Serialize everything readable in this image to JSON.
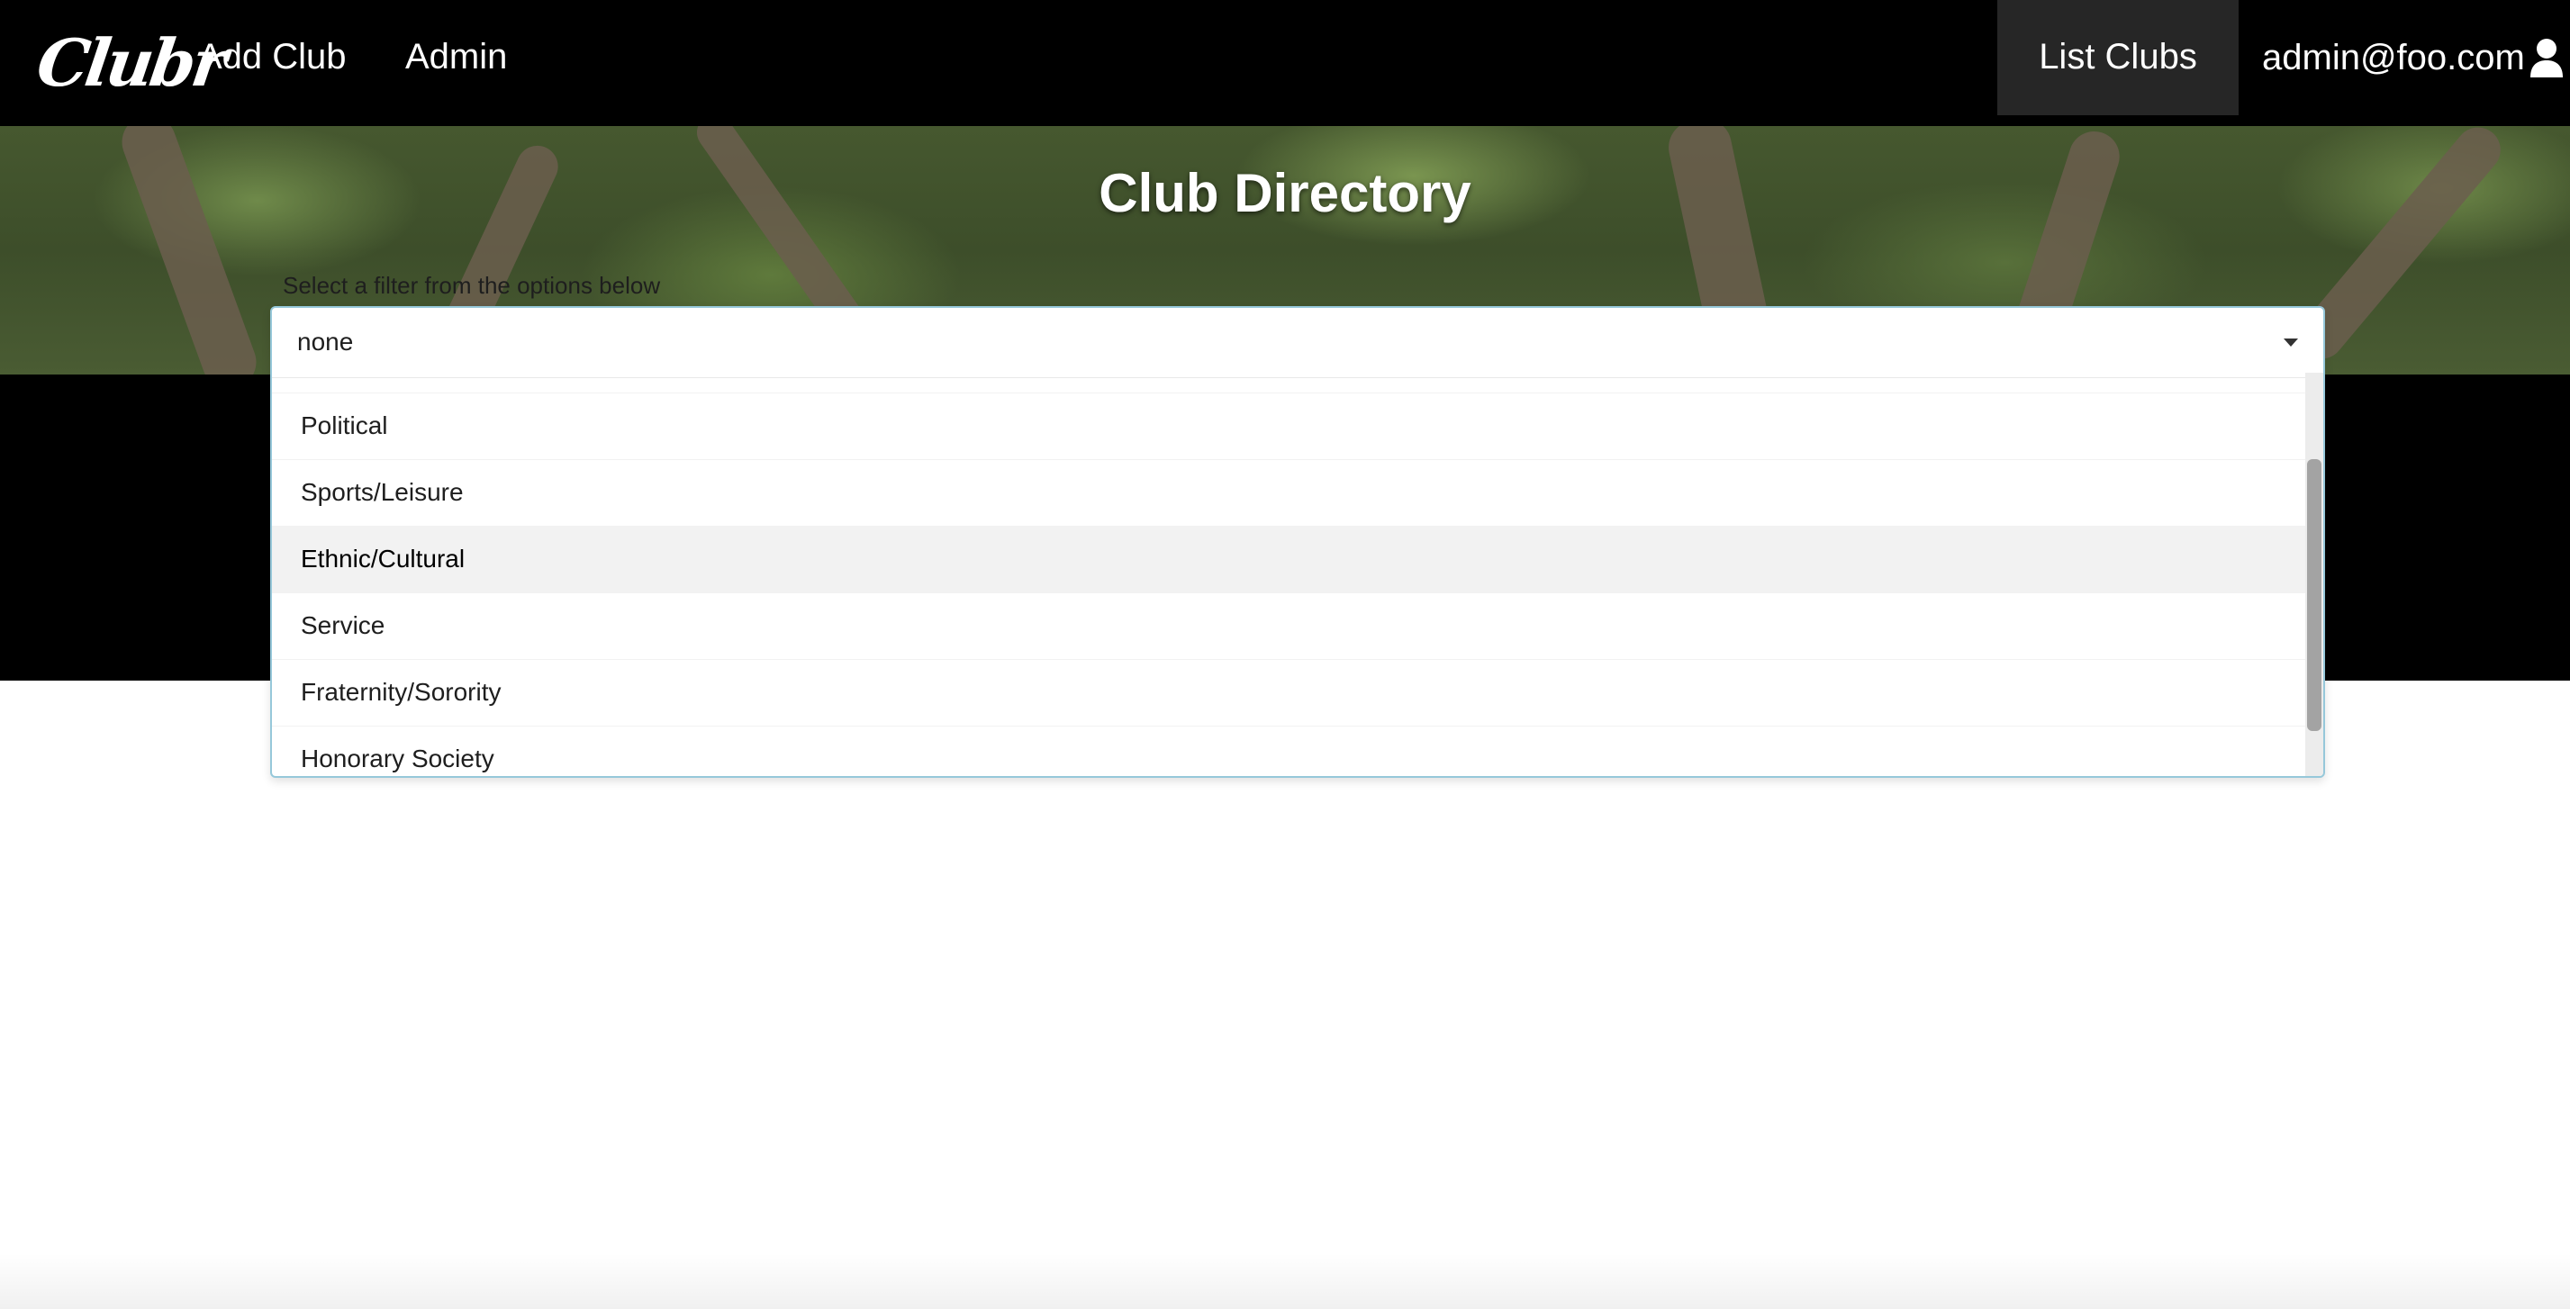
{
  "navbar": {
    "brand": "Clubr",
    "links": {
      "add_club": "Add Club",
      "admin": "Admin",
      "list_clubs": "List Clubs"
    },
    "user_email": "admin@foo.com",
    "user_icon": "user-icon"
  },
  "hero": {
    "title": "Club Directory",
    "hint": "Select a filter from the options below"
  },
  "filter": {
    "selected": "none",
    "options": [
      "Political",
      "Sports/Leisure",
      "Ethnic/Cultural",
      "Service",
      "Fraternity/Sorority",
      "Honorary Society"
    ],
    "highlighted_option": "Ethnic/Cultural"
  },
  "colors": {
    "navbar_bg": "#000000",
    "active_nav_bg": "#262626",
    "dropdown_border": "#96c8da",
    "highlight_bg": "#f2f2f2"
  }
}
